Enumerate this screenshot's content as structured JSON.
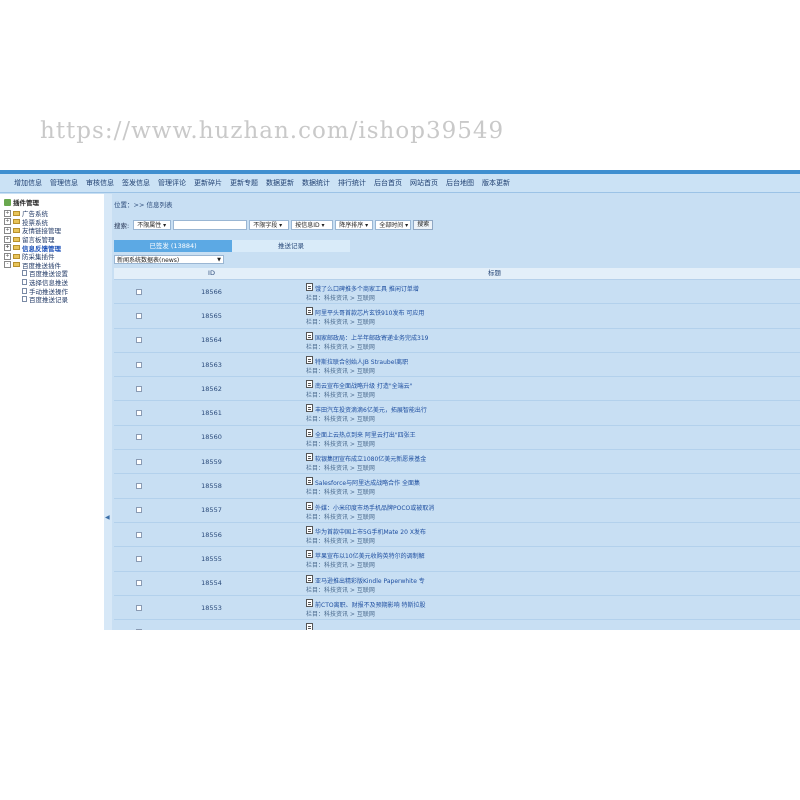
{
  "watermark": "https://www.huzhan.com/ishop39549",
  "menu": [
    "增加信息",
    "管理信息",
    "审核信息",
    "签发信息",
    "管理评论",
    "更新碎片",
    "更新专题",
    "数据更新",
    "数据统计",
    "排行统计",
    "后台首页",
    "网站首页",
    "后台地图",
    "版本更新"
  ],
  "sidebar": {
    "root": "插件管理",
    "items": [
      {
        "label": "广告系统",
        "pm": "+"
      },
      {
        "label": "投票系统",
        "pm": "+"
      },
      {
        "label": "友情链接管理",
        "pm": "+"
      },
      {
        "label": "留言板管理",
        "pm": "+"
      },
      {
        "label": "信息反馈管理",
        "pm": "+",
        "active": true
      },
      {
        "label": "防采集插件",
        "pm": "+"
      },
      {
        "label": "百度推送插件",
        "pm": "-"
      }
    ],
    "subitems": [
      "百度推送设置",
      "选择信息推送",
      "手动推送操作",
      "百度推送记录"
    ]
  },
  "breadcrumb": "位置：>> 信息列表",
  "search": {
    "label": "搜索:",
    "attr_select": "不限属性",
    "field_select": "不限字段",
    "order_field": "按信息ID",
    "order_dir": "降序排序",
    "time_select": "全部时间",
    "button": "搜索"
  },
  "tabs": [
    "已签发 (13884)",
    "推送记录"
  ],
  "model_select": "新闻系统数据表(news)",
  "table": {
    "headers": [
      "ID",
      "标题"
    ],
    "category": "栏目：科技资讯 > 互联网",
    "rows": [
      {
        "id": "18566",
        "title": "饿了么口碑推多个商家工具 推闲订单增"
      },
      {
        "id": "18565",
        "title": "阿里平头哥首款芯片玄铁910发布 可应用"
      },
      {
        "id": "18564",
        "title": "国家邮政局：上半年邮政寄递业务完成319"
      },
      {
        "id": "18563",
        "title": "特斯拉联合创始人JB Straubel离职"
      },
      {
        "id": "18562",
        "title": "南云宣布全面战略升级 打造\"全端云\""
      },
      {
        "id": "18561",
        "title": "丰田汽车投资滴滴6亿美元，拓展智能出行"
      },
      {
        "id": "18560",
        "title": "全面上云热点到来 阿里云打出\"四张王"
      },
      {
        "id": "18559",
        "title": "软银集团宣布成立1080亿美元新愿景基金"
      },
      {
        "id": "18558",
        "title": "Salesforce与阿里达成战略合作 全面集"
      },
      {
        "id": "18557",
        "title": "外媒：小米印度市场手机品牌POCO或被取消"
      },
      {
        "id": "18556",
        "title": "华为首款中国上市5G手机Mate 20 X发布"
      },
      {
        "id": "18555",
        "title": "苹果宣布以10亿美元收购英特尔的调制解"
      },
      {
        "id": "18554",
        "title": "亚马逊推出精彩版Kindle Paperwhite 专"
      },
      {
        "id": "18553",
        "title": "前CTO离职、财报不及预期影响 特斯拉股"
      },
      {
        "id": "",
        "title": ""
      }
    ]
  }
}
